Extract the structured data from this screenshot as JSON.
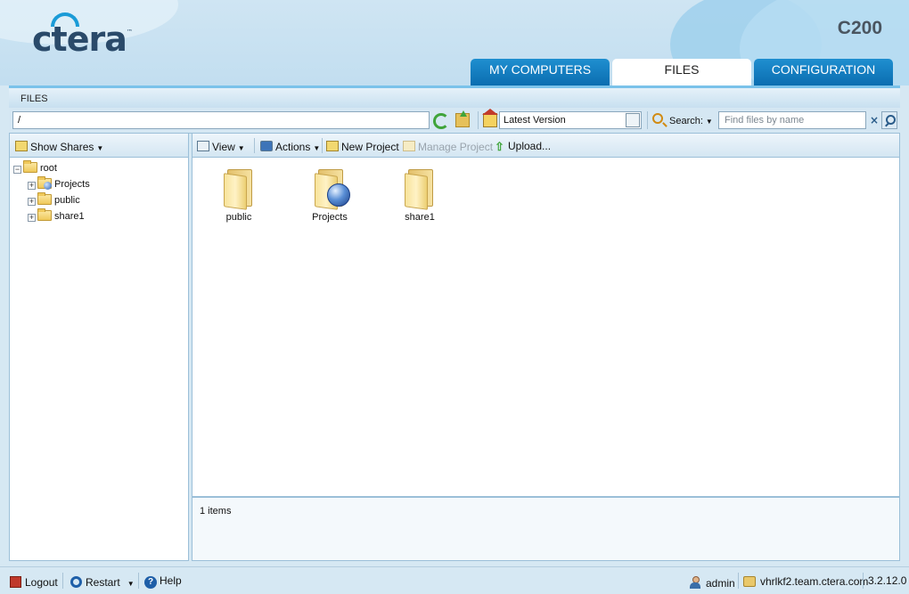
{
  "header": {
    "logo_text": "ctera",
    "logo_tm": "™",
    "model": "C200",
    "tabs": [
      {
        "label": "MY COMPUTERS",
        "active": false
      },
      {
        "label": "FILES",
        "active": true
      },
      {
        "label": "CONFIGURATION",
        "active": false
      }
    ]
  },
  "band": {
    "title": "FILES"
  },
  "pathbar": {
    "path_value": "/",
    "version_value": "Latest Version",
    "search_label": "Search:",
    "search_placeholder": "Find files by name",
    "clear_glyph": "×"
  },
  "left": {
    "show_shares_label": "Show Shares",
    "tree": [
      {
        "label": "root",
        "expander": "−"
      },
      {
        "label": "Projects",
        "expander": "+"
      },
      {
        "label": "public",
        "expander": "+"
      },
      {
        "label": "share1",
        "expander": "+"
      }
    ]
  },
  "toolbar": {
    "view_label": "View",
    "actions_label": "Actions",
    "new_project_label": "New Project",
    "manage_project_label": "Manage Project",
    "upload_label": "Upload..."
  },
  "files": [
    {
      "name": "public",
      "icon": "folder-icon"
    },
    {
      "name": "Projects",
      "icon": "project-folder-icon"
    },
    {
      "name": "share1",
      "icon": "folder-icon"
    }
  ],
  "status": {
    "items_text": "1 items"
  },
  "footer": {
    "logout_label": "Logout",
    "restart_label": "Restart",
    "help_label": "Help",
    "user": "admin",
    "device": "vhrlkf2.team.ctera.com",
    "version": "3.2.12.0"
  },
  "colors": {
    "accent": "#0b6db0",
    "band_border": "#7ac2ea",
    "background": "#d6e8f3"
  }
}
